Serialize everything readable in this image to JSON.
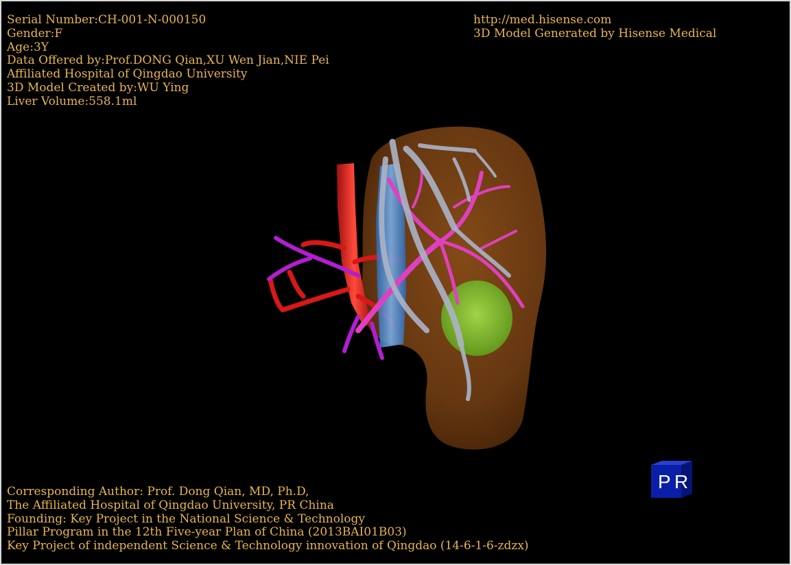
{
  "info_top_left": [
    "Serial Number:CH-001-N-000150",
    "Gender:F",
    "Age:3Y",
    "Data Offered by:Prof.DONG Qian,XU Wen Jian,NIE Pei",
    "Affiliated Hospital of Qingdao University",
    "3D Model Created by:WU Ying",
    "Liver Volume:558.1ml"
  ],
  "info_top_right": [
    "http://med.hisense.com",
    "3D Model Generated by Hisense Medical"
  ],
  "info_bottom_left": [
    "Corresponding Author: Prof. Dong Qian, MD, Ph.D,",
    "The Affiliated Hospital of Qingdao University, PR China",
    "Founding: Key Project in the National Science & Technology",
    "Pillar Program in the 12th Five-year Plan of China (2013BAI01B03)",
    "Key Project of independent Science & Technology innovation of Qingdao (14-6-1-6-zdzx)"
  ],
  "orientation_cube": {
    "left_label": "P",
    "right_label": "R"
  },
  "colors": {
    "background": "#000000",
    "text": "#e8b64c",
    "liver": "#6b3a12",
    "hepatic_vein": "#aab4c8",
    "portal_vein": "#e040c0",
    "artery": "#d81818",
    "ivc": "#4a8fd8",
    "tumor": "#7cc22a",
    "cube": "#0a1fa8"
  }
}
